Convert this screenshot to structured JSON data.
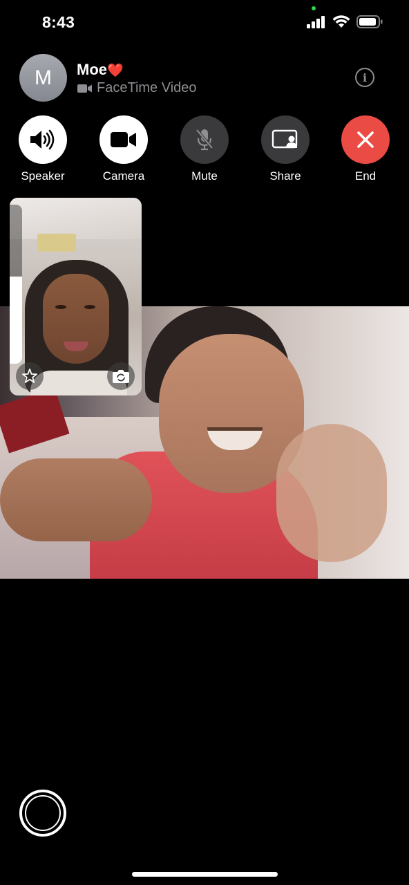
{
  "status_bar": {
    "time": "8:43",
    "icons": [
      "cellular-signal-icon",
      "wifi-icon",
      "battery-icon"
    ],
    "mic_indicator_color": "#32d74b"
  },
  "call": {
    "avatar_initial": "M",
    "contact_name": "Moe",
    "name_emoji": "❤️",
    "call_type": "FaceTime Video",
    "call_type_icon": "video-camera-icon",
    "info_icon": "info-icon"
  },
  "controls": [
    {
      "label": "Speaker",
      "icon": "speaker-icon",
      "style": "white"
    },
    {
      "label": "Camera",
      "icon": "video-camera-icon",
      "style": "white"
    },
    {
      "label": "Mute",
      "icon": "microphone-slash-icon",
      "style": "gray"
    },
    {
      "label": "Share",
      "icon": "shareplay-icon",
      "style": "gray"
    },
    {
      "label": "End",
      "icon": "close-icon",
      "style": "red"
    }
  ],
  "self_view": {
    "effects_icon": "effects-star-icon",
    "flip_icon": "camera-flip-icon",
    "zoom_level": 0.55
  },
  "colors": {
    "end_red": "#eb4b45",
    "control_gray": "#3a3a3c",
    "secondary_text": "#8e8e93"
  },
  "bottom": {
    "shutter_icon": "live-photo-shutter-icon"
  }
}
